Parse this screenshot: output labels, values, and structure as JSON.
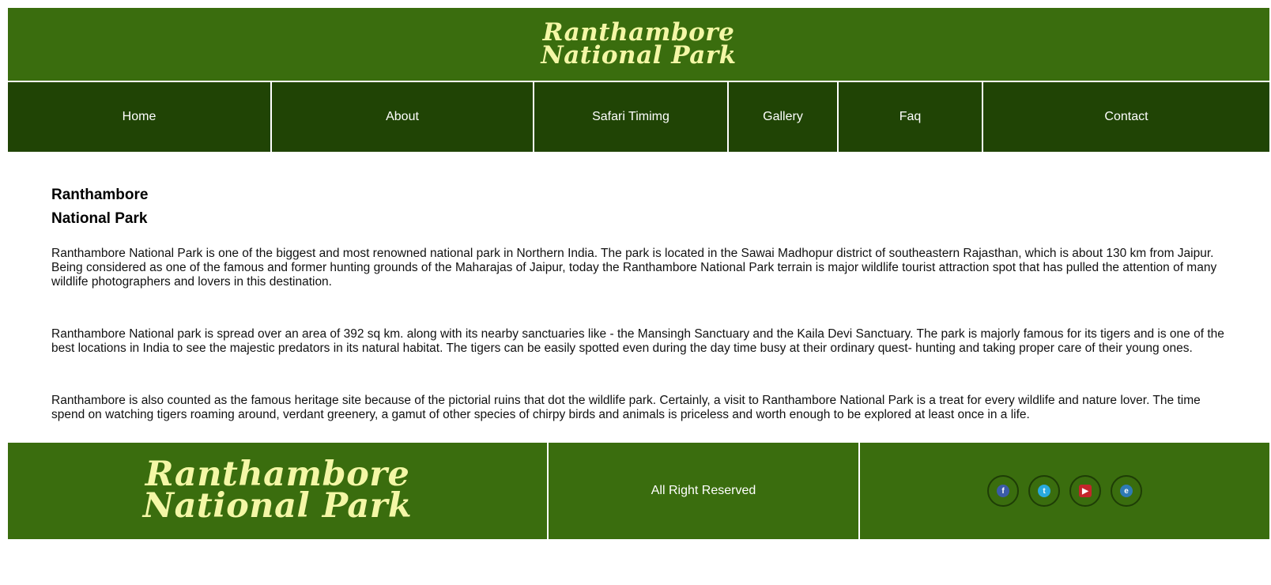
{
  "header": {
    "logo_line1": "Ranthambore",
    "logo_line2": "National Park"
  },
  "nav": {
    "items": [
      {
        "label": "Home"
      },
      {
        "label": "About"
      },
      {
        "label": "Safari Timimg"
      },
      {
        "label": "Gallery"
      },
      {
        "label": "Faq"
      },
      {
        "label": "Contact"
      }
    ]
  },
  "main": {
    "title_line1": "Ranthambore",
    "title_line2": "National Park",
    "paragraphs": [
      "Ranthambore National Park is one of the biggest and most renowned national park in Northern India. The park is located in the Sawai Madhopur district of southeastern Rajasthan, which is about 130 km from Jaipur. Being considered as one of the famous and former hunting grounds of the Maharajas of Jaipur, today the Ranthambore National Park terrain is major wildlife tourist attraction spot that has pulled the attention of many wildlife photographers and lovers in this destination.",
      "Ranthambore National park is spread over an area of 392 sq km. along with its nearby sanctuaries like - the Mansingh Sanctuary and the Kaila Devi Sanctuary. The park is majorly famous for its tigers and is one of the best locations in India to see the majestic predators in its natural habitat. The tigers can be easily spotted even during the day time busy at their ordinary quest- hunting and taking proper care of their young ones.",
      "Ranthambore is also counted as the famous heritage site because of the pictorial ruins that dot the wildlife park. Certainly, a visit to Ranthambore National Park is a treat for every wildlife and nature lover. The time spend on watching tigers roaming around, verdant greenery, a gamut of other species of chirpy birds and animals is priceless and worth enough to be explored at least once in a life."
    ]
  },
  "footer": {
    "logo_line1": "Ranthambore",
    "logo_line2": "National Park",
    "copyright": "All Right Reserved",
    "social": [
      {
        "icon": "facebook-icon",
        "glyph": "f",
        "color": "#3b5ba8"
      },
      {
        "icon": "twitter-icon",
        "glyph": "t",
        "color": "#29a9df"
      },
      {
        "icon": "youtube-icon",
        "glyph": "▶",
        "color": "#c4262b"
      },
      {
        "icon": "email-icon",
        "glyph": "e",
        "color": "#2e7ab5"
      }
    ]
  },
  "colors": {
    "header_bg": "#3a6d0e",
    "nav_bg": "#204405",
    "logo": "#f4f7a6"
  }
}
